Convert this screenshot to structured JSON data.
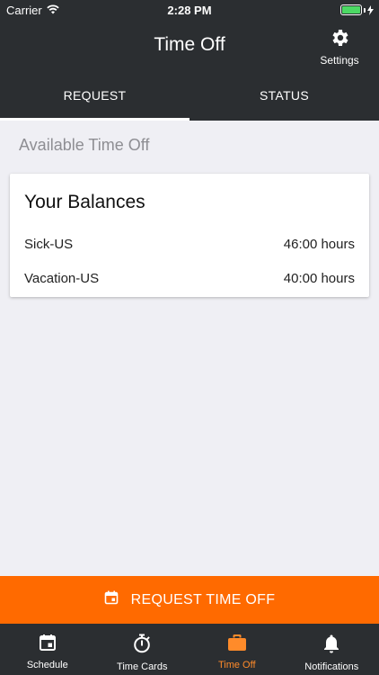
{
  "status_bar": {
    "carrier": "Carrier",
    "time": "2:28 PM"
  },
  "header": {
    "title": "Time Off",
    "settings_label": "Settings",
    "settings_icon": "gear-icon"
  },
  "tabs": [
    {
      "label": "REQUEST",
      "active": true
    },
    {
      "label": "STATUS",
      "active": false
    }
  ],
  "section_title": "Available Time Off",
  "balances": {
    "title": "Your Balances",
    "rows": [
      {
        "name": "Sick-US",
        "value": "46:00 hours"
      },
      {
        "name": "Vacation-US",
        "value": "40:00 hours"
      }
    ]
  },
  "action_button": {
    "label": "REQUEST TIME OFF",
    "icon": "calendar-icon"
  },
  "bottom_nav": [
    {
      "label": "Schedule",
      "icon": "calendar-icon",
      "active": false
    },
    {
      "label": "Time Cards",
      "icon": "stopwatch-icon",
      "active": false
    },
    {
      "label": "Time Off",
      "icon": "briefcase-icon",
      "active": true
    },
    {
      "label": "Notifications",
      "icon": "bell-icon",
      "active": false
    }
  ],
  "colors": {
    "accent": "#ff6a00",
    "active_tab": "#ff8b2a",
    "bar": "#2b2e31",
    "background": "#efeff4"
  }
}
